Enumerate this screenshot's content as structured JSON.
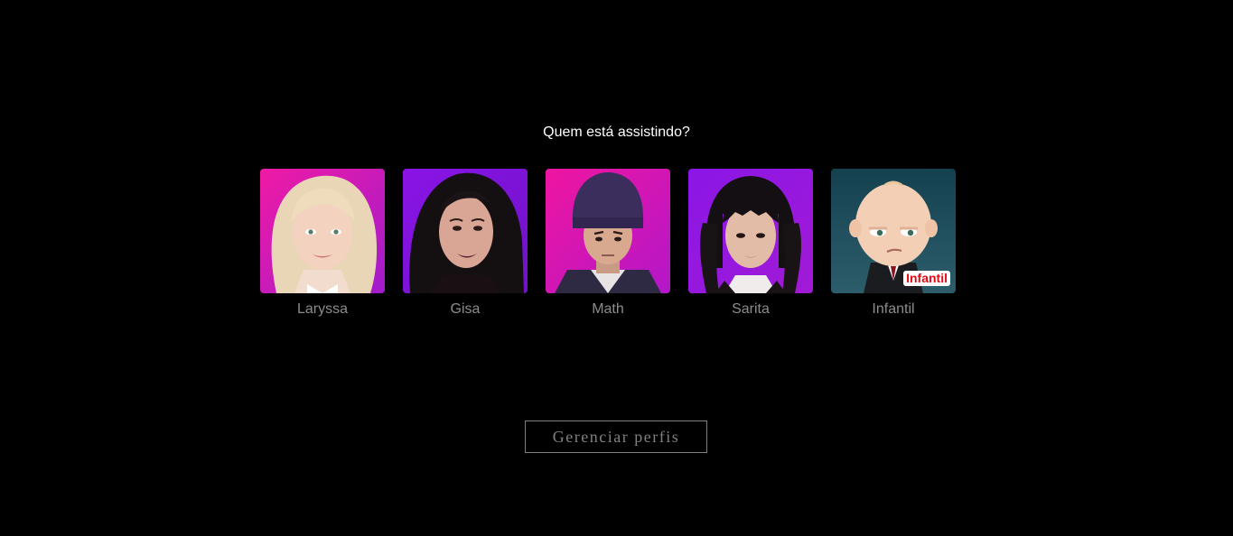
{
  "heading": "Quem está assistindo?",
  "profiles": [
    {
      "name": "Laryssa",
      "avatar_icon": "blonde-girl-avatar-icon",
      "bg_color": "#e0129b"
    },
    {
      "name": "Gisa",
      "avatar_icon": "dark-haired-woman-avatar-icon",
      "bg_color": "#7a14d9"
    },
    {
      "name": "Math",
      "avatar_icon": "boy-beanie-avatar-icon",
      "bg_color": "#e0129b"
    },
    {
      "name": "Sarita",
      "avatar_icon": "braided-girl-avatar-icon",
      "bg_color": "#8b1ae0"
    },
    {
      "name": "Infantil",
      "avatar_icon": "boss-baby-avatar-icon",
      "bg_color": "#1b3a48",
      "badge": "Infantil"
    }
  ],
  "manage_button": "Gerenciar perfis",
  "colors": {
    "background": "#000000",
    "heading": "#ffffff",
    "profile_name": "#8c8c8c",
    "button": "#808080",
    "kids_badge": "#e50914"
  }
}
